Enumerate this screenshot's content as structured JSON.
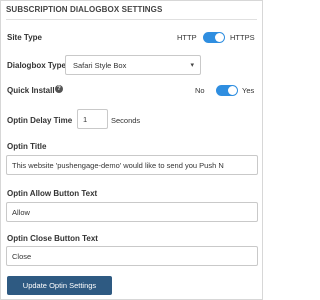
{
  "panel": {
    "title": "SUBSCRIPTION DIALOGBOX SETTINGS"
  },
  "site_type": {
    "label": "Site Type",
    "option_left": "HTTP",
    "option_right": "HTTPS",
    "selected": "HTTPS"
  },
  "dialogbox_type": {
    "label": "Dialogbox Type",
    "value": "Safari Style Box"
  },
  "quick_install": {
    "label": "Quick Install",
    "option_left": "No",
    "option_right": "Yes",
    "selected": "Yes"
  },
  "optin_delay": {
    "label": "Optin Delay Time",
    "value": "1",
    "unit": "Seconds"
  },
  "optin_title": {
    "label": "Optin Title",
    "value": "This website 'pushengage-demo' would like to send you Push N"
  },
  "allow_button_text": {
    "label": "Optin Allow Button Text",
    "value": "Allow"
  },
  "close_button_text": {
    "label": "Optin Close Button Text",
    "value": "Close"
  },
  "submit_label": "Update Optin Settings",
  "colors": {
    "toggle_on": "#2f8ee0",
    "button_bg": "#2e5a82"
  },
  "icons": {
    "help": "question-circle-icon",
    "dropdown": "chevron-down-icon"
  }
}
